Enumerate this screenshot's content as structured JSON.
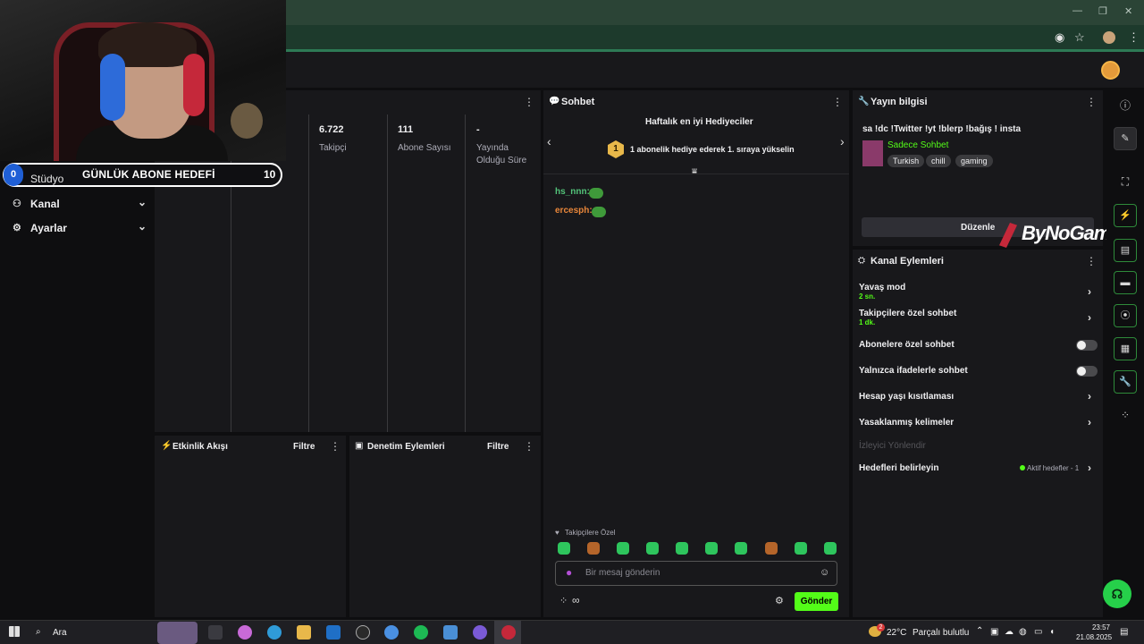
{
  "webcam": {
    "label": "Streamer webcam"
  },
  "goal": {
    "start": "0",
    "title": "GÜNLÜK ABONE HEDEFİ",
    "end": "10",
    "progress_fraction": 0
  },
  "sidebar": {
    "studio": "Stüdyo",
    "items": [
      {
        "label": "Kanal",
        "icon": "channel-icon"
      },
      {
        "label": "Ayarlar",
        "icon": "gear-icon"
      }
    ]
  },
  "stats": [
    {
      "value": "6.722",
      "label": "Takipçi"
    },
    {
      "value": "111",
      "label": "Abone Sayısı"
    },
    {
      "value": "-",
      "label": "Yayında Olduğu Süre"
    }
  ],
  "activity": {
    "title": "Etkinlik Akışı",
    "filter": "Filtre"
  },
  "moderation": {
    "title": "Denetim Eylemleri",
    "filter": "Filtre"
  },
  "chat": {
    "title": "Sohbet",
    "gifters_title": "Haftalık en iyi Hediyeciler",
    "rank": "1",
    "gifters_text": "1 abonelik hediye ederek 1. sıraya yükselin",
    "messages": [
      {
        "user": "hs_nnn:",
        "color": "#53c47a"
      },
      {
        "user": "ercesph:",
        "color": "#e8863a"
      }
    ],
    "followers_only": "Takipçilere Özel",
    "placeholder": "Bir mesaj gönderin",
    "send": "Gönder",
    "infinity": "∞"
  },
  "stream_info": {
    "title": "Yayın bilgisi",
    "stream_title": "sa !dc !Twitter !yt !blerp !bağış ! insta",
    "category": "Sadece Sohbet",
    "tags": [
      "Turkish",
      "chill",
      "gaming"
    ],
    "edit": "Düzenle"
  },
  "watermark": "ByNoGame",
  "channel_actions": {
    "title": "Kanal Eylemleri",
    "rows": [
      {
        "label": "Yavaş mod",
        "sub": "2 sn."
      },
      {
        "label": "Takipçilere özel sohbet",
        "sub": "1 dk."
      },
      {
        "label": "Abonelere özel sohbet"
      },
      {
        "label": "Yalnızca ifadelerle sohbet"
      },
      {
        "label": "Hesap yaşı kısıtlaması"
      },
      {
        "label": "Yasaklanmış kelimeler"
      },
      {
        "label": "İzleyici Yönlendir"
      },
      {
        "label": "Hedefleri belirleyin",
        "sub": "Aktif hedefler - 1"
      }
    ]
  },
  "taskbar": {
    "search": "Ara",
    "weather": "22°C",
    "weather_desc": "Parçalı bulutlu",
    "weather_badge": "2",
    "time": "23:57",
    "date": "21.08.2025"
  },
  "colors": {
    "accent": "#53fc18",
    "panel": "#18181b",
    "background": "#0e0e10"
  }
}
